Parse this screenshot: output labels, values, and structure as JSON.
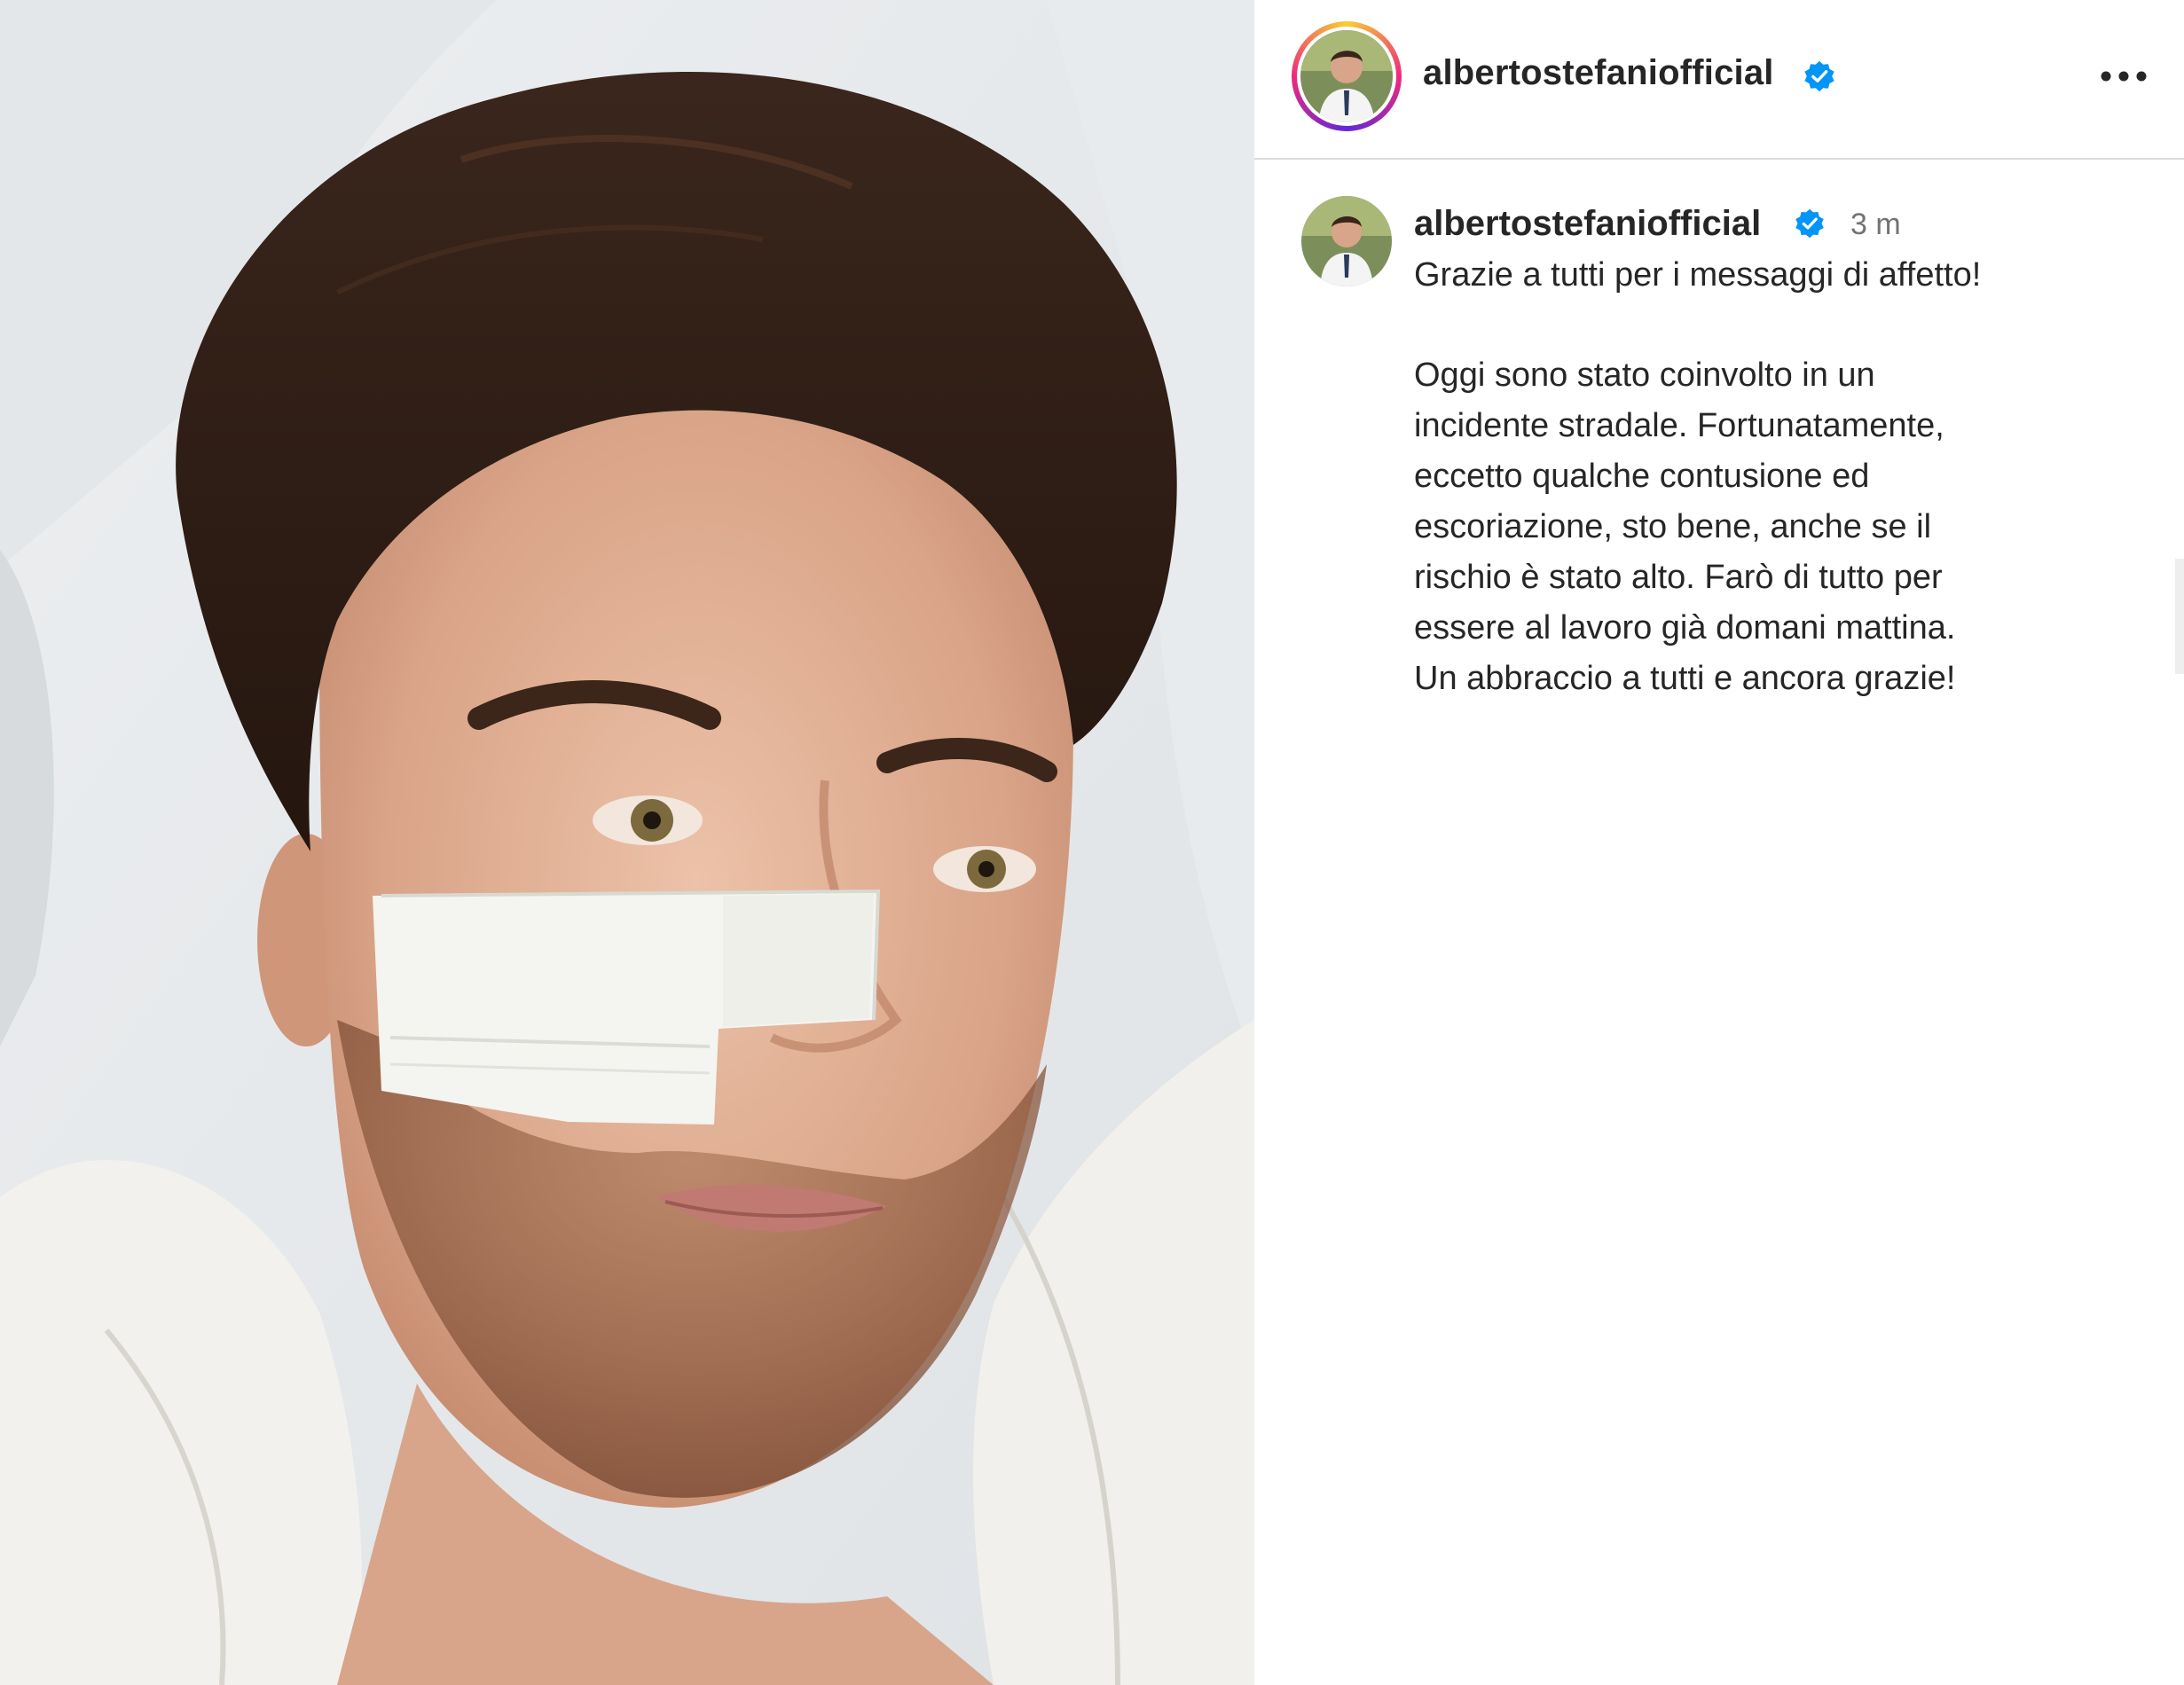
{
  "post": {
    "username": "albertostefaniofficial",
    "verified": true,
    "more_icon": "more-horizontal-icon",
    "colors": {
      "story_ring": [
        "#f9ce34",
        "#ee2a7b",
        "#6228d7"
      ],
      "verified_blue": "#0095f6",
      "text": "#262626",
      "muted": "#737373"
    }
  },
  "caption": {
    "username": "albertostefaniofficial",
    "time": "3 m",
    "lines_first": [
      "Grazie a tutti per i messaggi di affetto!"
    ],
    "lines_second": [
      "Oggi sono stato coinvolto in un",
      "incidente stradale. Fortunatamente,",
      "eccetto qualche contusione ed",
      "escoriazione, sto bene, anche se il",
      "rischio è stato alto. Farò di tutto per",
      "essere al lavoro già domani mattina.",
      "Un abbraccio a tutti e ancora grazie!"
    ]
  }
}
